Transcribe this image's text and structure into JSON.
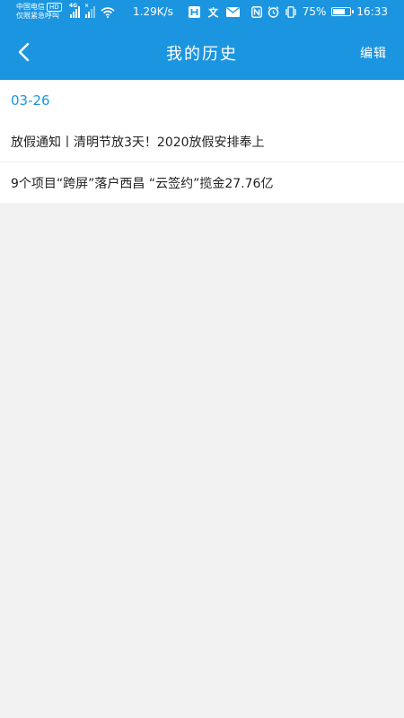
{
  "status_bar": {
    "carrier_line1": "中国电信",
    "carrier_hd": "HD",
    "carrier_line2": "仅限紧急呼叫",
    "signal_label_1": "4G",
    "signal_label_2": "×",
    "net_speed": "1.29K/s",
    "battery_percent": "75%",
    "battery_level": 0.75,
    "time": "16:33",
    "icons": [
      "signal-icon",
      "wifi-icon",
      "app-h-icon",
      "app-wen-icon",
      "mail-icon",
      "nfc-icon",
      "alarm-icon",
      "vibrate-icon",
      "battery-icon"
    ]
  },
  "header": {
    "title": "我的历史",
    "edit_label": "编辑",
    "back_icon": "back-arrow-icon"
  },
  "history": {
    "date": "03-26",
    "items": [
      {
        "title": "放假通知丨清明节放3天！2020放假安排奉上"
      },
      {
        "title": "9个项目“跨屏”落户西昌 “云签约”揽金27.76亿"
      }
    ]
  },
  "colors": {
    "accent": "#1b95e0",
    "background": "#f2f2f2",
    "text": "#222222"
  }
}
